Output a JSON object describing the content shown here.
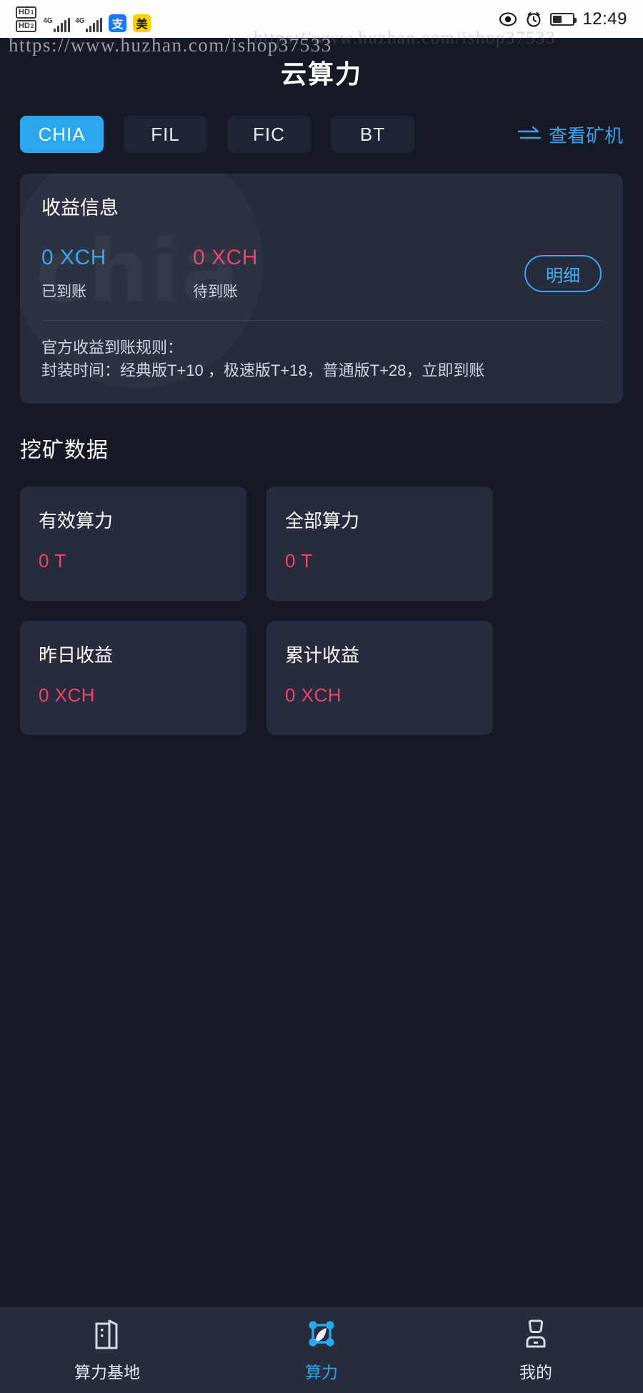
{
  "status_bar": {
    "hd_labels": [
      "HD 1",
      "HD 2"
    ],
    "network_labels": [
      "4G",
      "4G"
    ],
    "apps": [
      {
        "name": "alipay-app-icon",
        "glyph": "支"
      },
      {
        "name": "meituan-app-icon",
        "glyph": "美"
      }
    ],
    "time": "12:49"
  },
  "watermark": {
    "url": "https://www.huzhan.com/ishop37533"
  },
  "header": {
    "title": "云算力"
  },
  "tabs": [
    {
      "label": "CHIA",
      "active": true
    },
    {
      "label": "FIL",
      "active": false
    },
    {
      "label": "FIC",
      "active": false
    },
    {
      "label": "BT",
      "active": false
    }
  ],
  "view_miners": {
    "label": "查看矿机",
    "icon": "swap-arrows-icon"
  },
  "income": {
    "title": "收益信息",
    "ghost_text": "chia",
    "received": {
      "value": "0 XCH",
      "label": "已到账"
    },
    "pending": {
      "value": "0 XCH",
      "label": "待到账"
    },
    "detail_button": "明细",
    "rules_heading": "官方收益到账规则：",
    "rules_body": "封装时间：经典版T+10 ，极速版T+18，普通版T+28，立即到账"
  },
  "mining": {
    "section_title": "挖矿数据",
    "cards": [
      {
        "label": "有效算力",
        "value": "0 T"
      },
      {
        "label": "全部算力",
        "value": "0 T"
      },
      {
        "label": "昨日收益",
        "value": "0 XCH"
      },
      {
        "label": "累计收益",
        "value": "0 XCH"
      }
    ]
  },
  "bottom_nav": [
    {
      "label": "算力基地",
      "icon": "building-icon",
      "active": false
    },
    {
      "label": "算力",
      "icon": "network-nodes-icon",
      "active": true
    },
    {
      "label": "我的",
      "icon": "person-icon",
      "active": false
    }
  ],
  "colors": {
    "accent_blue": "#2ba7ef",
    "value_red": "#f0426b",
    "value_blue": "#3ba6ec",
    "page_bg": "#141925",
    "card_bg": "#262b3d"
  }
}
